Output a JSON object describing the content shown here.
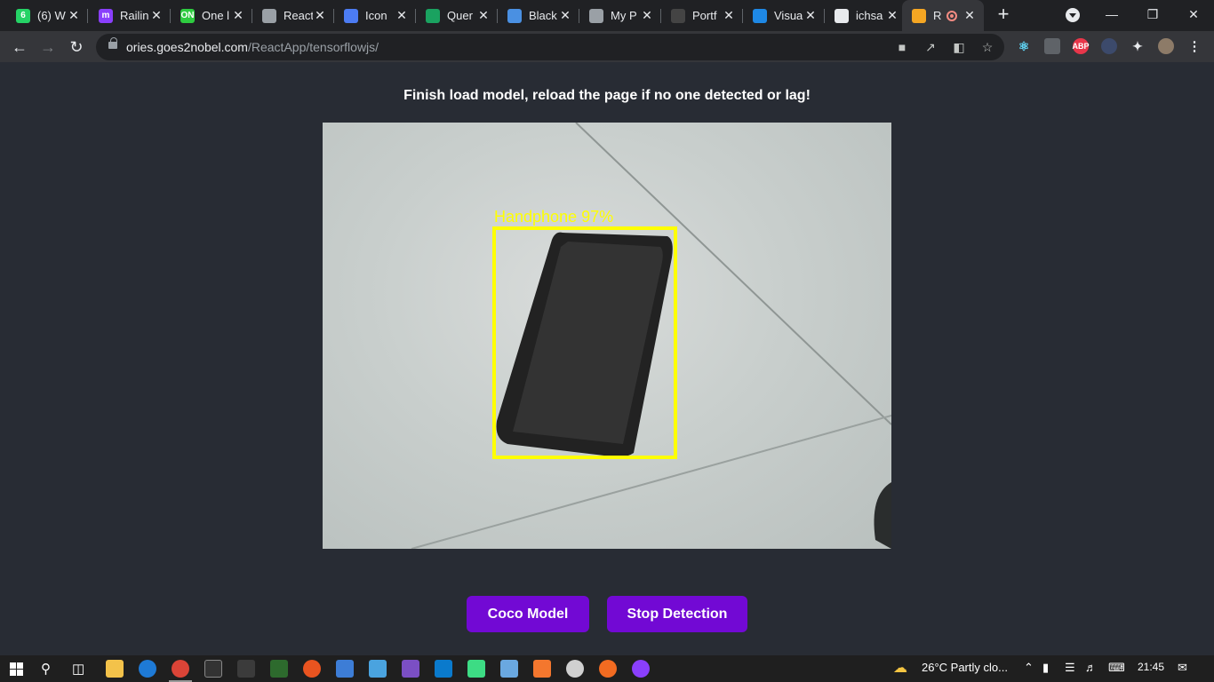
{
  "browser": {
    "tabs": [
      {
        "title": "(6) W",
        "icon": "whatsapp-icon",
        "color": "#25d366",
        "glyph": "6"
      },
      {
        "title": "Railin",
        "icon": "railway-icon",
        "color": "#8a3ffc",
        "glyph": "m"
      },
      {
        "title": "One l",
        "icon": "one-icon",
        "color": "#2ecc40",
        "glyph": "ON"
      },
      {
        "title": "React",
        "icon": "globe-icon",
        "color": "#9aa0a6",
        "glyph": ""
      },
      {
        "title": "Icon",
        "icon": "diamond-icon",
        "color": "#4c7cf3",
        "glyph": ""
      },
      {
        "title": "Quer",
        "icon": "query-icon",
        "color": "#1aa260",
        "glyph": ""
      },
      {
        "title": "Black",
        "icon": "document-icon",
        "color": "#4a90e2",
        "glyph": ""
      },
      {
        "title": "My P",
        "icon": "globe-icon",
        "color": "#9aa0a6",
        "glyph": ""
      },
      {
        "title": "Portf",
        "icon": "portfolio-icon",
        "color": "#444444",
        "glyph": ""
      },
      {
        "title": "Visua",
        "icon": "filter-icon",
        "color": "#1e88e5",
        "glyph": ""
      },
      {
        "title": "ichsa",
        "icon": "github-icon",
        "color": "#e8eaed",
        "glyph": ""
      },
      {
        "title": "R",
        "icon": "hexagon-icon",
        "color": "#f5a623",
        "glyph": "",
        "active": true,
        "recording": true
      }
    ],
    "new_tab": "+",
    "url_domain": "ories.goes2nobel.com",
    "url_path": "/ReactApp/tensorflowjs/",
    "window": {
      "minimize": "—",
      "restore": "❐",
      "close": "✕"
    }
  },
  "page": {
    "status_text": "Finish load model, reload the page if no one detected or lag!",
    "detection": {
      "label": "Handphone 97%",
      "class_name": "Handphone",
      "confidence": 0.97,
      "box_color": "#ffff00"
    },
    "buttons": {
      "coco": "Coco Model",
      "stop": "Stop Detection"
    },
    "accent": "#7209d4",
    "background": "#282c34"
  },
  "taskbar": {
    "weather": "26°C  Partly clo...",
    "time": "21:45"
  }
}
